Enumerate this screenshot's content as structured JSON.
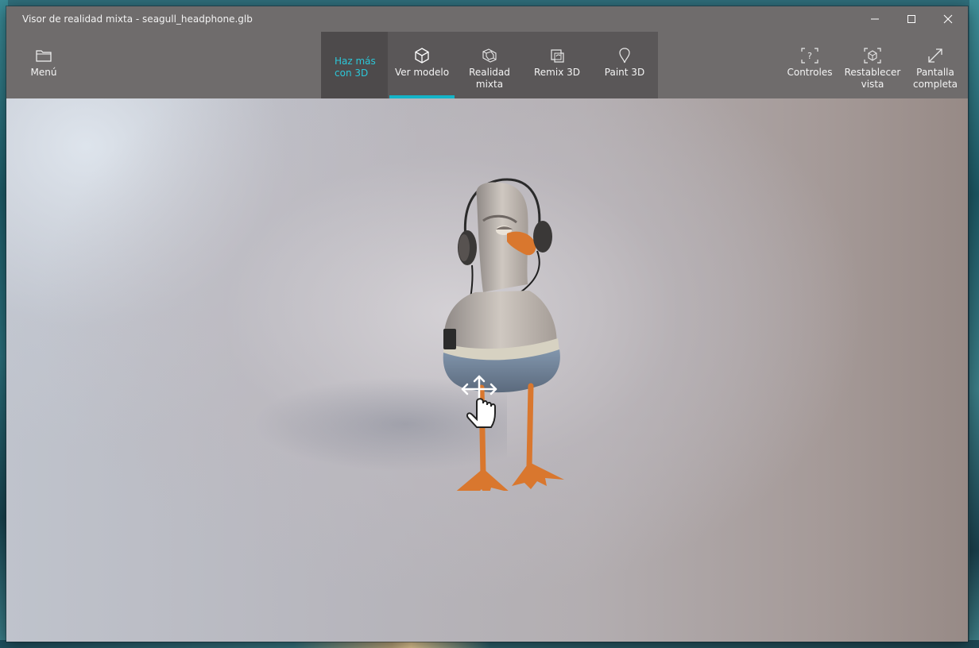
{
  "window": {
    "title": "Visor de realidad mixta - seagull_headphone.glb"
  },
  "titlebar_buttons": {
    "minimize_icon": "minimize-icon",
    "maximize_icon": "maximize-icon",
    "close_icon": "close-icon"
  },
  "toolbar": {
    "menu": {
      "label": "Menú",
      "icon": "folder-icon"
    },
    "haz_mas": {
      "label": "Haz más\ncon 3D",
      "color": "#2cc7d8"
    },
    "tabs": [
      {
        "label": "Ver modelo",
        "icon": "cube-icon",
        "selected": true
      },
      {
        "label": "Realidad\nmixta",
        "icon": "mixed-reality-icon",
        "selected": false
      },
      {
        "label": "Remix 3D",
        "icon": "remix-icon",
        "selected": false
      },
      {
        "label": "Paint 3D",
        "icon": "paint-3d-icon",
        "selected": false
      }
    ],
    "right": [
      {
        "label": "Controles",
        "icon": "controls-help-icon"
      },
      {
        "label": "Restablecer\nvista",
        "icon": "reset-view-icon"
      },
      {
        "label": "Pantalla\ncompleta",
        "icon": "fullscreen-icon"
      }
    ],
    "accent": "#15b4c8"
  },
  "viewport": {
    "model_name": "seagull_headphone.glb",
    "gesture_icon": "pan-gesture-icon"
  }
}
